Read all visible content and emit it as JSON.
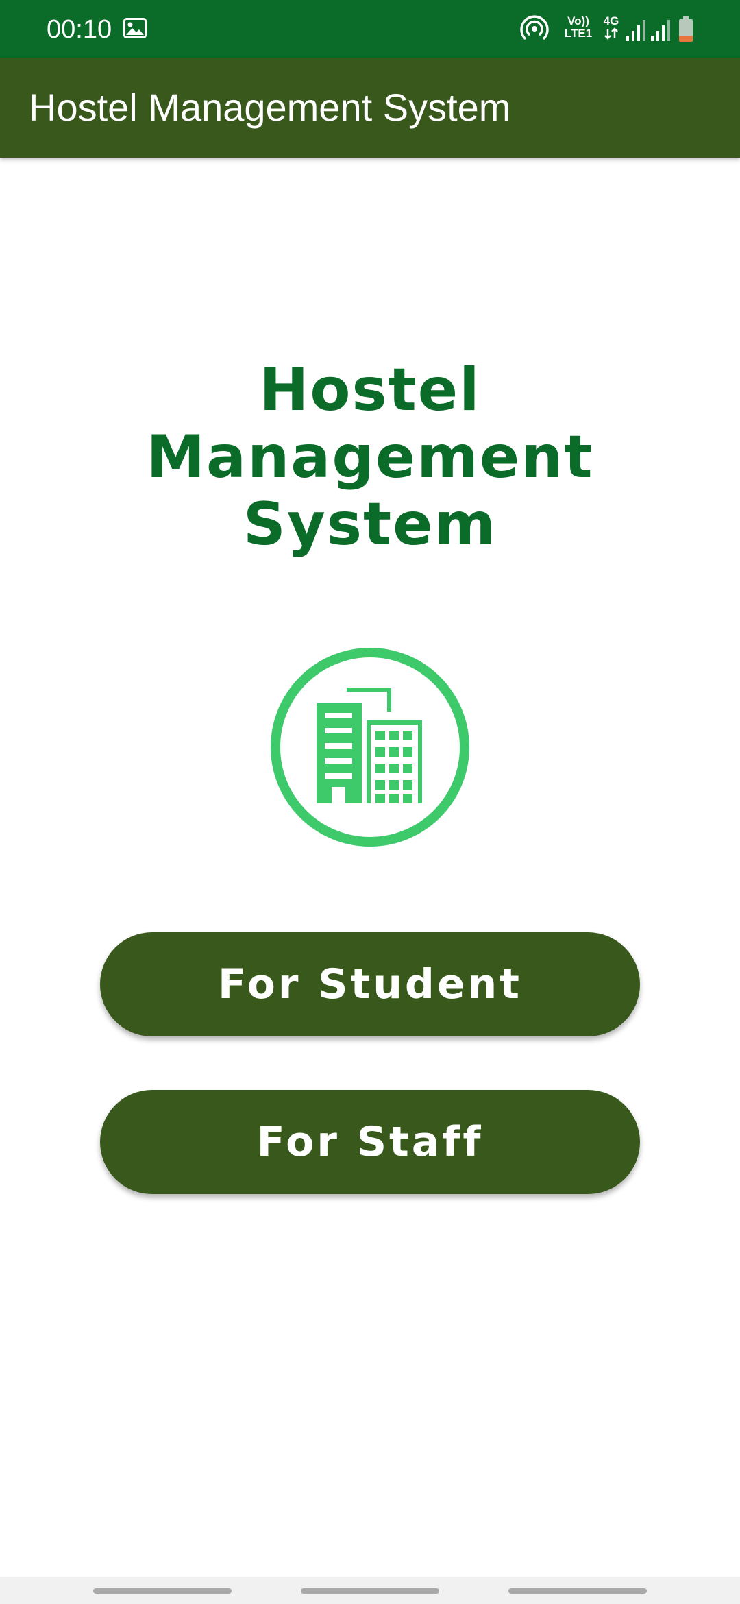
{
  "status_bar": {
    "time": "00:10",
    "volte_top": "Vo))",
    "volte_bottom": "LTE1",
    "network_type": "4G",
    "icons": [
      "gallery-icon",
      "hotspot-icon",
      "signal-icon",
      "signal-icon",
      "battery-icon"
    ],
    "background_color": "#0b6b28"
  },
  "app_bar": {
    "title": "Hostel Management System",
    "background_color": "#38591b"
  },
  "main": {
    "headline": "Hostel Management System",
    "logo_icon": "building-icon",
    "logo_color": "#3ec96a",
    "buttons": {
      "student": "For Student",
      "staff": "For Staff"
    },
    "button_color": "#38591b"
  }
}
